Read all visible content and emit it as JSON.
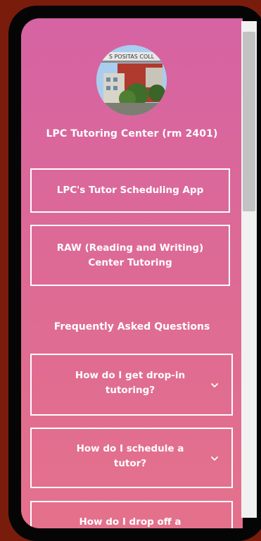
{
  "profile": {
    "title": "LPC Tutoring Center (rm 2401)",
    "avatar_sign_text": "S POSITAS COLL"
  },
  "links": [
    {
      "label": "LPC's Tutor Scheduling App"
    },
    {
      "label": "RAW (Reading and Writing) Center Tutoring"
    }
  ],
  "faq": {
    "heading": "Frequently Asked Questions",
    "items": [
      {
        "question": "How do I get drop-in tutoring?",
        "icon": "chevron-down-icon"
      },
      {
        "question": "How do I schedule a tutor?",
        "icon": "chevron-down-icon"
      },
      {
        "question": "How do I drop off a",
        "icon": "chevron-down-icon"
      }
    ]
  },
  "colors": {
    "gradient_top": "#d663a3",
    "gradient_bottom": "#e4718c",
    "text": "#ffffff",
    "outer_background": "#7a1c0c"
  }
}
